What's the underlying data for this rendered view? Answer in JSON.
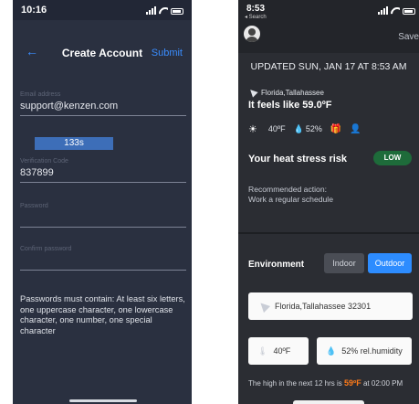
{
  "left": {
    "status_time": "10:16",
    "nav": {
      "back_icon": "←",
      "title": "Create Account",
      "submit": "Submit"
    },
    "email": {
      "label": "Email address",
      "value": "support@kenzen.com"
    },
    "timer": "133s",
    "code": {
      "label": "Verification Code",
      "value": "837899"
    },
    "password": {
      "label": "Password",
      "value": ""
    },
    "confirm": {
      "label": "Confirm password",
      "value": ""
    },
    "rules": "Passwords must contain: At least six letters, one uppercase character, one lowercase character, one number, one special character"
  },
  "right": {
    "status_time": "8:53",
    "breadcrumb": "◂ Search",
    "save": "Save",
    "updated": "UPDATED SUN, JAN 17 AT 8:53 AM",
    "location": "Florida,Tallahassee",
    "feels": "It feels like 59.0ºF",
    "weather": {
      "sun_icon": "☀",
      "temp": "40ºF",
      "drop_icon": "💧",
      "humidity": "52%",
      "gift_icon": "🎁",
      "person_icon": "👤"
    },
    "heat_title": "Your heat stress risk",
    "risk_level": "LOW",
    "recommend_label": "Recommended action:",
    "recommend_text": "Work a regular schedule",
    "environment": {
      "label": "Environment",
      "indoor": "Indoor",
      "outdoor": "Outdoor"
    },
    "location_full": "Florida,Tallahassee 32301",
    "temp_field": "40ºF",
    "humidity_field": "52% rel.humidity",
    "high": {
      "prefix": "The high in the next 12 hrs is ",
      "value": "59ºF",
      "suffix": " at 02:00 PM"
    }
  },
  "colors": {
    "accent_blue": "#3a8dff",
    "risk_green": "#1e6b3a",
    "high_orange": "#ff7b1a"
  }
}
